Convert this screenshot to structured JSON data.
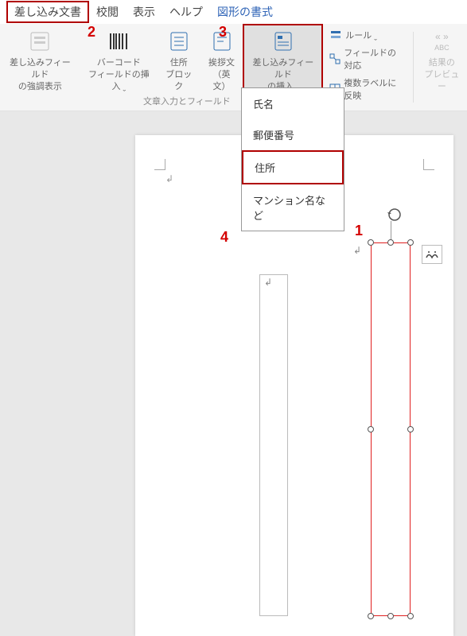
{
  "menubar": {
    "items": [
      {
        "label": "差し込み文書",
        "active": true
      },
      {
        "label": "校閲"
      },
      {
        "label": "表示"
      },
      {
        "label": "ヘルプ"
      },
      {
        "label": "図形の書式",
        "blue": true
      }
    ]
  },
  "ribbon": {
    "buttons": {
      "highlight_fields": {
        "line1": "差し込みフィールド",
        "line2": "の強調表示"
      },
      "barcode": {
        "line1": "バーコード",
        "line2": "フィールドの挿入 ˬ"
      },
      "address_block": {
        "line1": "住所",
        "line2": "ブロック"
      },
      "greeting": {
        "line1": "挨拶文",
        "line2": "（英文）"
      },
      "insert_merge": {
        "line1": "差し込みフィールド",
        "line2": "の挿入 ˬ"
      }
    },
    "mini": {
      "rules": "ルール ˬ",
      "match_fields": "フィールドの対応",
      "update_labels": "複数ラベルに反映"
    },
    "preview": {
      "line1": "結果の",
      "line2": "プレビュー",
      "abc": "ABC"
    },
    "group_caption": "文章入力とフィールド"
  },
  "dropdown": {
    "items": [
      {
        "label": "氏名"
      },
      {
        "label": "郵便番号"
      },
      {
        "label": "住所",
        "selected": true
      },
      {
        "label": "マンション名など"
      }
    ]
  },
  "steps": {
    "s1": "1",
    "s2": "2",
    "s3": "3",
    "s4": "4"
  },
  "marks": {
    "anchor": "↲",
    "tb1": "↲",
    "shape": "↲"
  }
}
